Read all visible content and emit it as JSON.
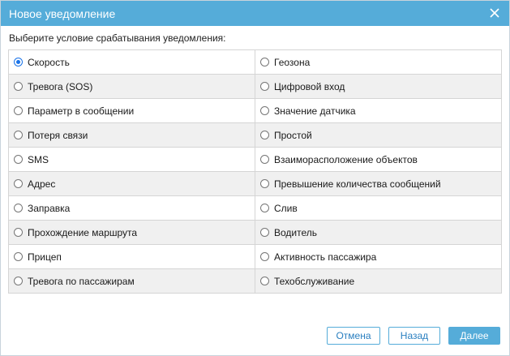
{
  "dialog": {
    "title": "Новое уведомление",
    "prompt": "Выберите условие срабатывания уведомления:"
  },
  "options": [
    {
      "left": "Скорость",
      "right": "Геозона"
    },
    {
      "left": "Тревога (SOS)",
      "right": "Цифровой вход"
    },
    {
      "left": "Параметр в сообщении",
      "right": "Значение датчика"
    },
    {
      "left": "Потеря связи",
      "right": "Простой"
    },
    {
      "left": "SMS",
      "right": "Взаиморасположение объектов"
    },
    {
      "left": "Адрес",
      "right": "Превышение количества сообщений"
    },
    {
      "left": "Заправка",
      "right": "Слив"
    },
    {
      "left": "Прохождение маршрута",
      "right": "Водитель"
    },
    {
      "left": "Прицеп",
      "right": "Активность пассажира"
    },
    {
      "left": "Тревога по пассажирам",
      "right": "Техобслуживание"
    }
  ],
  "selected": "Скорость",
  "buttons": {
    "cancel": "Отмена",
    "back": "Назад",
    "next": "Далее"
  },
  "colors": {
    "titlebar": "#55acd9",
    "radio_selected": "#1a73e8",
    "row_alt": "#f0f0f0"
  }
}
